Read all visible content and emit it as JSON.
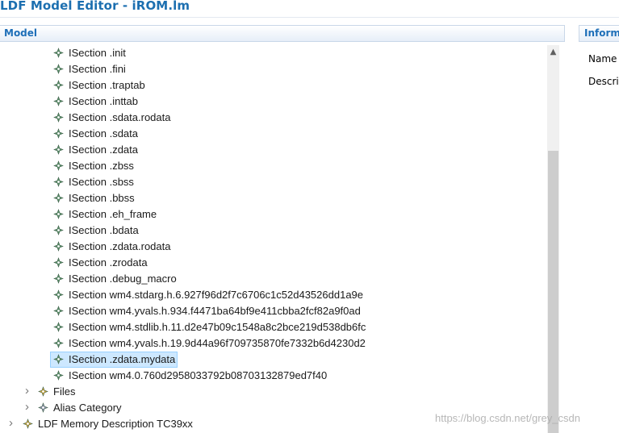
{
  "window": {
    "title": "LDF Model Editor - iROM.lm"
  },
  "model_panel": {
    "title": "Model"
  },
  "info_panel": {
    "title": "Inform",
    "name_label": "Name",
    "description_label": "Descri"
  },
  "tree": {
    "sections": [
      "ISection .init",
      "ISection .fini",
      "ISection .traptab",
      "ISection .inttab",
      "ISection .sdata.rodata",
      "ISection .sdata",
      "ISection .zdata",
      "ISection .zbss",
      "ISection .sbss",
      "ISection .bbss",
      "ISection .eh_frame",
      "ISection .bdata",
      "ISection .zdata.rodata",
      "ISection .zrodata",
      "ISection .debug_macro",
      "ISection wm4.stdarg.h.6.927f96d2f7c6706c1c52d43526dd1a9e",
      "ISection wm4.yvals.h.934.f4471ba64bf9e411cbba2fcf82a9f0ad",
      "ISection wm4.stdlib.h.11.d2e47b09c1548a8c2bce219d538db6fc",
      "ISection wm4.yvals.h.19.9d44a96f709735870fe7332b6d4230d2",
      "ISection .zdata.mydata",
      "ISection wm4.0.760d2958033792b08703132879ed7f40"
    ],
    "selected_section": "ISection .zdata.mydata",
    "files_label": "Files",
    "alias_category_label": "Alias Category",
    "memory_description_label": "LDF Memory Description TC39xx"
  },
  "watermark": "https://blog.csdn.net/grey_csdn",
  "colors": {
    "title": "#1c6fb0",
    "header_text": "#1e6fb8",
    "selection_bg": "#cde8ff",
    "selection_border": "#99d1ff",
    "icon_green": "#5a8f6a",
    "icon_gold": "#c9a23a"
  }
}
